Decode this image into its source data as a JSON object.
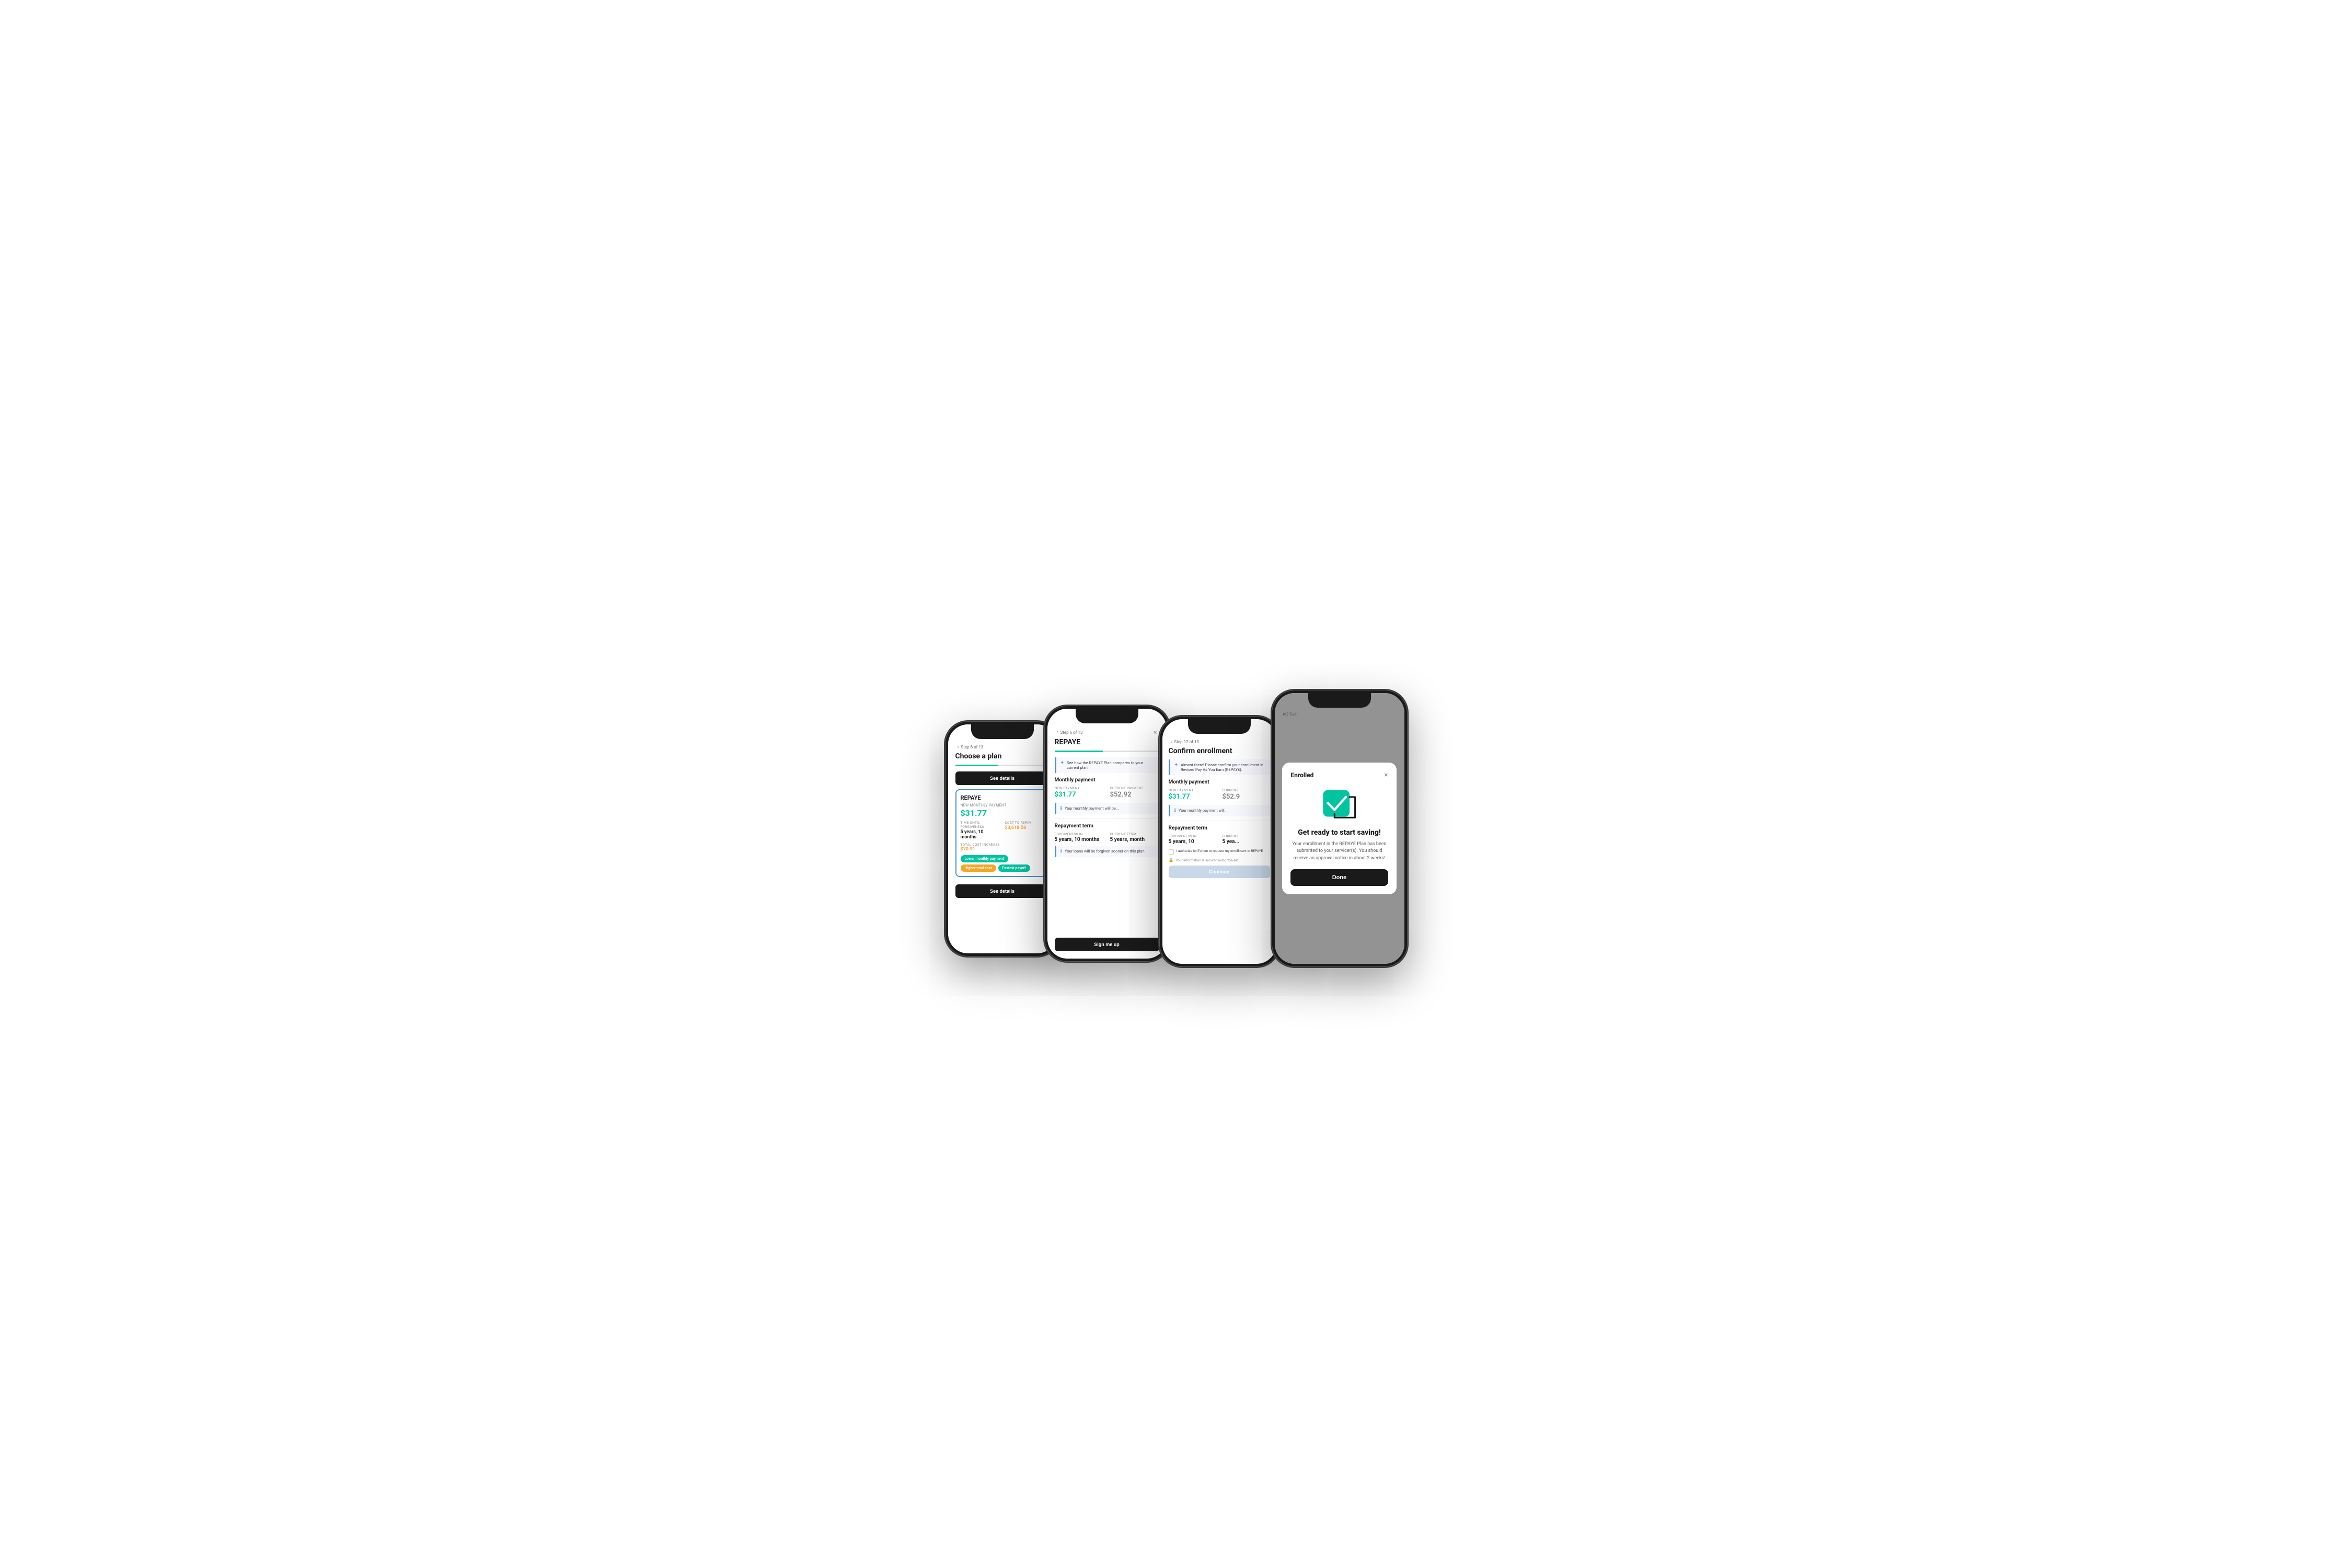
{
  "phone1": {
    "step": "Step 6 of 13",
    "title": "Choose a plan",
    "btn_see_details_top": "See details",
    "plan_name": "REPAYE",
    "new_monthly_payment_label": "NEW MONTHLY PAYMENT",
    "new_monthly_payment": "$31.77",
    "time_until_forgiveness_label": "TIME UNTIL FORGIVENESS",
    "time_until_forgiveness": "5 years, 10 months",
    "cost_to_repay_label": "COST TO REPAY",
    "cost_to_repay": "$3,618.58",
    "total_cost_increase_label": "TOTAL COST INCREASE",
    "total_cost_increase": "$70.91",
    "badge1": "Lower monthly payment",
    "badge2": "Higher total cost",
    "badge3": "Fastest payoff",
    "btn_see_details": "See details",
    "progress": 46
  },
  "phone2": {
    "step": "Step 6 of 13",
    "title": "REPAYE",
    "close_label": "×",
    "info_text": "See how the REPAYE Plan compares to your current plan.",
    "monthly_payment_title": "Monthly payment",
    "new_payment_label": "NEW PAYMENT",
    "new_payment_value": "$31.77",
    "current_payment_label": "CURRENT PAYMENT",
    "current_payment_value": "$52.92",
    "info_text2": "Your monthly payment will be...",
    "repayment_term_title": "Repayment term",
    "forgiveness_in_label": "FORGIVENESS IN",
    "forgiveness_in_value": "5 years, 10 months",
    "current_term_label": "CURRENT TERM",
    "current_term_value": "5 years, month",
    "info_text3": "Your loans will be forgiven sooner on this plan.",
    "btn_sign_me_up": "Sign me up",
    "progress": 46
  },
  "phone3": {
    "step": "Step 12 of 13",
    "title": "Confirm enrollment",
    "info_text": "Almost there! Please confirm your enrollment in Revised Pay As You Earn (REPAYE).",
    "monthly_payment_title": "Monthly payment",
    "new_payment_label": "NEW PAYMENT",
    "new_payment_value": "$31.77",
    "current_label": "CURRENT",
    "current_value": "$52.9",
    "info_text2": "Your monthly payment will...",
    "repayment_term_title": "Repayment term",
    "forgiveness_in_label": "FORGIVENESS IN",
    "forgiveness_in_value": "5 years, 10",
    "current_term_label": "CURRENT",
    "current_term_value": "5 yea...",
    "checkbox_text": "I authorize IonTuition to request my enrollment in REPAYE",
    "security_text": "Your information is secured using 256-bit...",
    "btn_continue": "Continue",
    "progress": 92
  },
  "phone4": {
    "modal_title": "Enrolled",
    "close_label": "×",
    "heading": "Get ready to start saving!",
    "description": "Your enrollment in the REPAYE Plan has been submitted to your servicer(s). You should receive an approval notice in about 2 weeks!",
    "btn_done": "Done",
    "icon_color": "#00c4a0"
  }
}
